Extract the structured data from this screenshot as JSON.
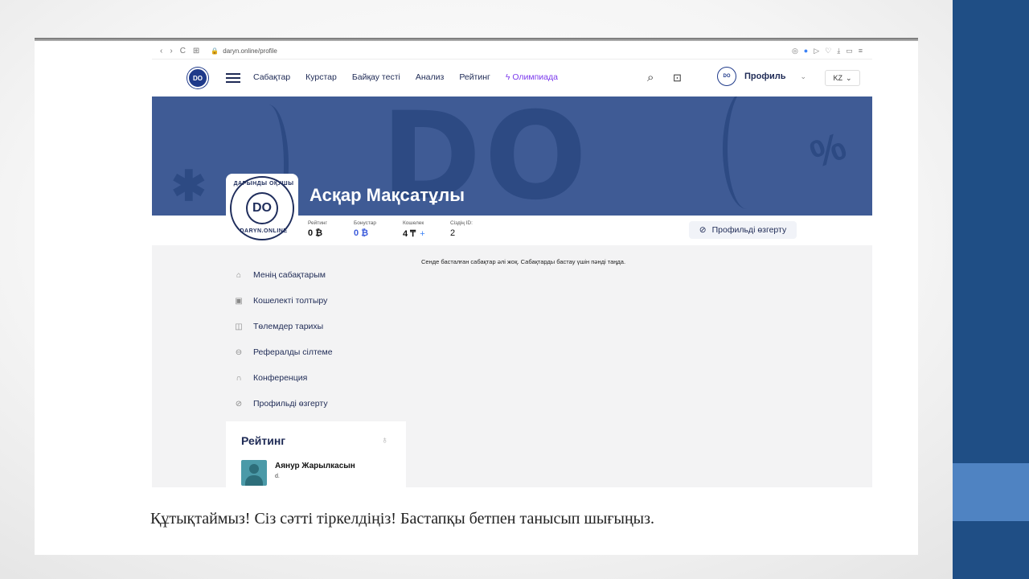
{
  "caption": "Құтықтаймыз! Сіз сәтті тіркелдіңіз! Бастапқы бетпен танысып шығыңыз.",
  "browser": {
    "url": "daryn.online/profile",
    "nav_glyphs": [
      "‹",
      "›",
      "C",
      "⊞"
    ]
  },
  "site": {
    "logo_text": "DO",
    "menu": [
      "Сабақтар",
      "Курстар",
      "Байқау тесті",
      "Анализ",
      "Рейтинг"
    ],
    "olympiad": "Олимпиада",
    "profile_label": "Профиль",
    "lang": "KZ"
  },
  "profile": {
    "name": "Асқар Мақсатұлы",
    "avatar_top": "ДАРЫНДЫ ОҚУШЫ",
    "avatar_center": "DO",
    "avatar_bottom": "DARYN.ONLINE",
    "stats": [
      {
        "label": "Рейтинг",
        "value": "0 ₿"
      },
      {
        "label": "Бонустар",
        "value": "0 ₿"
      },
      {
        "label": "Кошелек",
        "value": "4 ₸",
        "extra": "+"
      },
      {
        "label": "Сіздің ID:",
        "value": "2"
      }
    ],
    "edit_button": "Профильді өзгерту"
  },
  "sidebar": {
    "items": [
      {
        "label": "Менің сабақтарым",
        "icon": "book-icon"
      },
      {
        "label": "Кошелекті толтыру",
        "icon": "wallet-icon"
      },
      {
        "label": "Төлемдер тарихы",
        "icon": "history-icon"
      },
      {
        "label": "Рефералды сілтеме",
        "icon": "link-icon"
      },
      {
        "label": "Конференция",
        "icon": "headset-icon"
      },
      {
        "label": "Профильді өзгерту",
        "icon": "edit-icon"
      }
    ]
  },
  "main": {
    "empty_message": "Сенде басталған сабақтар әлі жоқ. Сабақтарды бастау үшін пәнді таңда."
  },
  "rating": {
    "title": "Рейтинг",
    "user_name": "Аянур Жарылкасын",
    "user_sub": "d."
  },
  "colors": {
    "band": "#1f4e85",
    "band_accent": "#4f83c2",
    "banner": "#3f5b95",
    "brand_navy": "#1e2a55"
  }
}
